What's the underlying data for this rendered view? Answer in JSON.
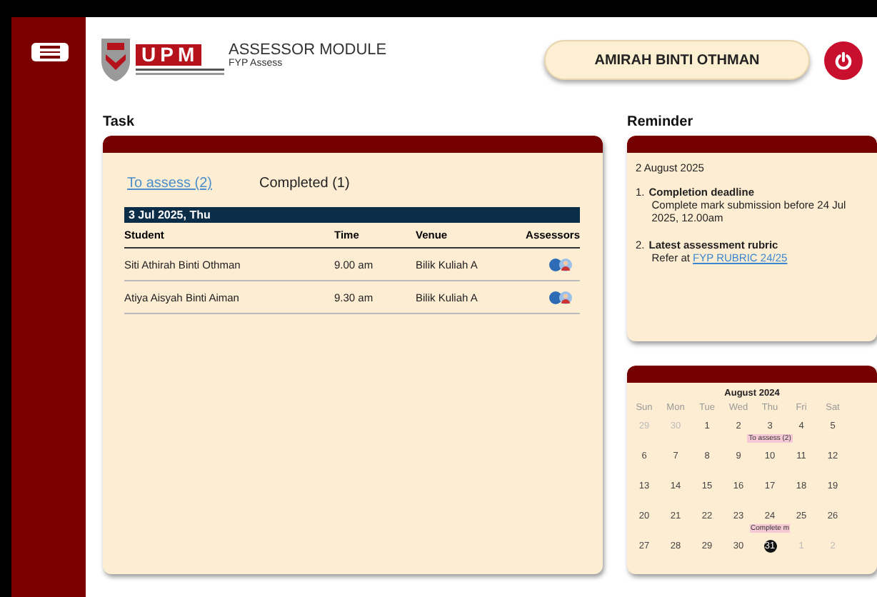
{
  "header": {
    "logo": "UPM",
    "module": "ASSESSOR MODULE",
    "subtitle": "FYP Assess",
    "user": "AMIRAH BINTI OTHMAN"
  },
  "task": {
    "title": "Task",
    "tabs": [
      {
        "label": "To assess (2)",
        "selected": true
      },
      {
        "label": "Completed (1)",
        "selected": false
      }
    ],
    "date": "3 Jul 2025, Thu",
    "columns": [
      "Student",
      "Time",
      "Venue",
      "Assessors"
    ],
    "rows": [
      {
        "student": "Siti Athirah Binti Othman",
        "time": "9.00 am",
        "venue": "Bilik Kuliah A"
      },
      {
        "student": "Atiya Aisyah Binti Aiman",
        "time": "9.30 am",
        "venue": "Bilik Kuliah A"
      }
    ]
  },
  "reminder": {
    "title": "Reminder",
    "date": "2 August  2025",
    "items": [
      {
        "number": "1.",
        "title": "Completion deadline",
        "text": "Complete mark submission before 24 Jul 2025, 12.00am"
      },
      {
        "number": "2.",
        "title": "Latest assessment rubric",
        "text": "Refer at ",
        "link": "FYP RUBRIC 24/25"
      }
    ]
  },
  "calendar": {
    "month": "August 2024",
    "weekdays": [
      "Sun",
      "Mon",
      "Tue",
      "Wed",
      "Thu",
      "Fri",
      "Sat"
    ],
    "days": [
      {
        "day": "29",
        "muted": true
      },
      {
        "day": "30",
        "muted": true
      },
      {
        "day": "1",
        "muted": false
      },
      {
        "day": "2",
        "muted": false
      },
      {
        "day": "3",
        "muted": false,
        "event": "To assess (2)"
      },
      {
        "day": "4",
        "muted": false
      },
      {
        "day": "5",
        "muted": false
      },
      {
        "day": "6",
        "muted": false
      },
      {
        "day": "7",
        "muted": false
      },
      {
        "day": "8",
        "muted": false
      },
      {
        "day": "9",
        "muted": false
      },
      {
        "day": "10",
        "muted": false
      },
      {
        "day": "11",
        "muted": false
      },
      {
        "day": "12",
        "muted": false
      },
      {
        "day": "13",
        "muted": false
      },
      {
        "day": "14",
        "muted": false
      },
      {
        "day": "15",
        "muted": false
      },
      {
        "day": "16",
        "muted": false
      },
      {
        "day": "17",
        "muted": false
      },
      {
        "day": "18",
        "muted": false
      },
      {
        "day": "19",
        "muted": false
      },
      {
        "day": "20",
        "muted": false
      },
      {
        "day": "21",
        "muted": false
      },
      {
        "day": "22",
        "muted": false
      },
      {
        "day": "23",
        "muted": false
      },
      {
        "day": "24",
        "muted": false,
        "event": "Complete m"
      },
      {
        "day": "25",
        "muted": false
      },
      {
        "day": "26",
        "muted": false
      },
      {
        "day": "27",
        "muted": false
      },
      {
        "day": "28",
        "muted": false
      },
      {
        "day": "29",
        "muted": false
      },
      {
        "day": "30",
        "muted": false
      },
      {
        "day": "31",
        "muted": false,
        "today": true
      },
      {
        "day": "1",
        "muted": true
      },
      {
        "day": "2",
        "muted": true
      }
    ]
  }
}
